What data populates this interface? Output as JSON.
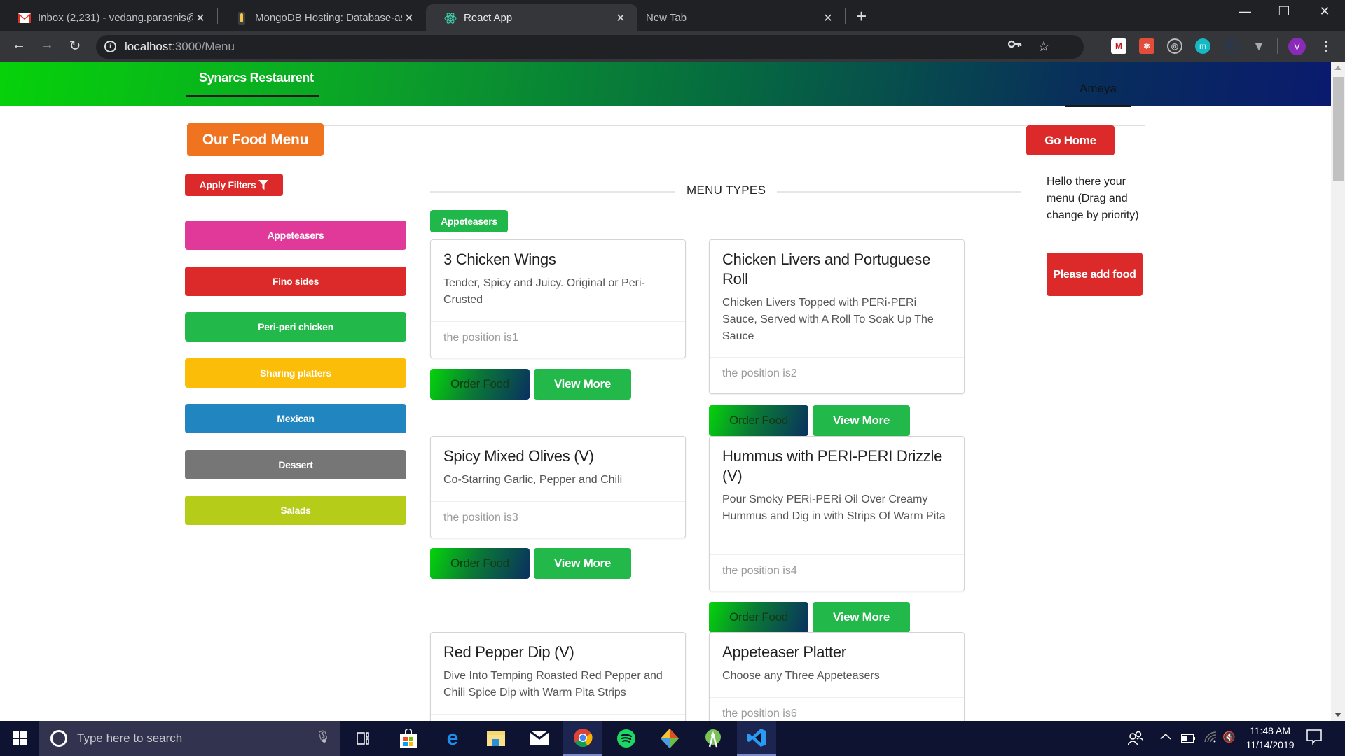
{
  "browser": {
    "tabs": [
      {
        "title": "Inbox (2,231) - vedang.parasnis@",
        "icon": "gmail-icon",
        "active": false
      },
      {
        "title": "MongoDB Hosting: Database-as-",
        "icon": "mongodb-icon",
        "active": false
      },
      {
        "title": "React App",
        "icon": "react-icon",
        "active": true
      },
      {
        "title": "New Tab",
        "icon": "",
        "active": false
      }
    ],
    "url_host": "localhost",
    "url_path": ":3000/Menu",
    "profile_initial": "V",
    "window_controls": {
      "minimize": "—",
      "restore": "❐",
      "close": "✕"
    }
  },
  "header": {
    "brand": "Synarcs Restaurent",
    "user": "Ameya",
    "gradient_colors": [
      "#06d20a",
      "#0a1a6e"
    ]
  },
  "page": {
    "title_button": "Our Food Menu",
    "go_home": "Go Home",
    "apply_filters": "Apply Filters",
    "menu_types_heading": "MENU TYPES",
    "selected_category_badge": "Appeteasers",
    "side_note": "Hello there your menu (Drag and change by priority)",
    "add_food": "Please add food"
  },
  "categories": [
    {
      "label": "Appeteasers",
      "color": "#e0399a"
    },
    {
      "label": "Fino sides",
      "color": "#dc2a2a"
    },
    {
      "label": "Peri-peri chicken",
      "color": "#22b84a"
    },
    {
      "label": "Sharing platters",
      "color": "#fbbd08"
    },
    {
      "label": "Mexican",
      "color": "#2185c0"
    },
    {
      "label": "Dessert",
      "color": "#767676"
    },
    {
      "label": "Salads",
      "color": "#b5cc18"
    }
  ],
  "foods": [
    {
      "title": "3 Chicken Wings",
      "description": "Tender, Spicy and Juicy. Original or Peri-Crusted",
      "position_text": "the position is1"
    },
    {
      "title": "Chicken Livers and Portuguese Roll",
      "description": "Chicken Livers Topped with PERi-PERi Sauce, Served with A Roll To Soak Up The Sauce",
      "position_text": "the position is2"
    },
    {
      "title": "Spicy Mixed Olives (V)",
      "description": "Co-Starring Garlic, Pepper and Chili",
      "position_text": "the position is3"
    },
    {
      "title": "Hummus with PERI-PERI Drizzle (V)",
      "description": "Pour Smoky PERi-PERi Oil Over Creamy Hummus and Dig in with Strips Of Warm Pita",
      "position_text": "the position is4"
    },
    {
      "title": "Red Pepper Dip (V)",
      "description": "Dive Into Temping Roasted Red Pepper and Chili Spice Dip with Warm Pita Strips",
      "position_text": ""
    },
    {
      "title": "Appeteaser Platter",
      "description": "Choose any Three Appeteasers",
      "position_text": "the position is6"
    }
  ],
  "card_buttons": {
    "order": "Order Food",
    "view": "View More"
  },
  "taskbar": {
    "search_placeholder": "Type here to search",
    "time": "11:48 AM",
    "date": "11/14/2019",
    "apps": [
      "task-view",
      "microsoft-store",
      "edge",
      "file-explorer",
      "mail",
      "chrome",
      "spotify",
      "git-kraken",
      "android-studio",
      "vscode"
    ]
  }
}
